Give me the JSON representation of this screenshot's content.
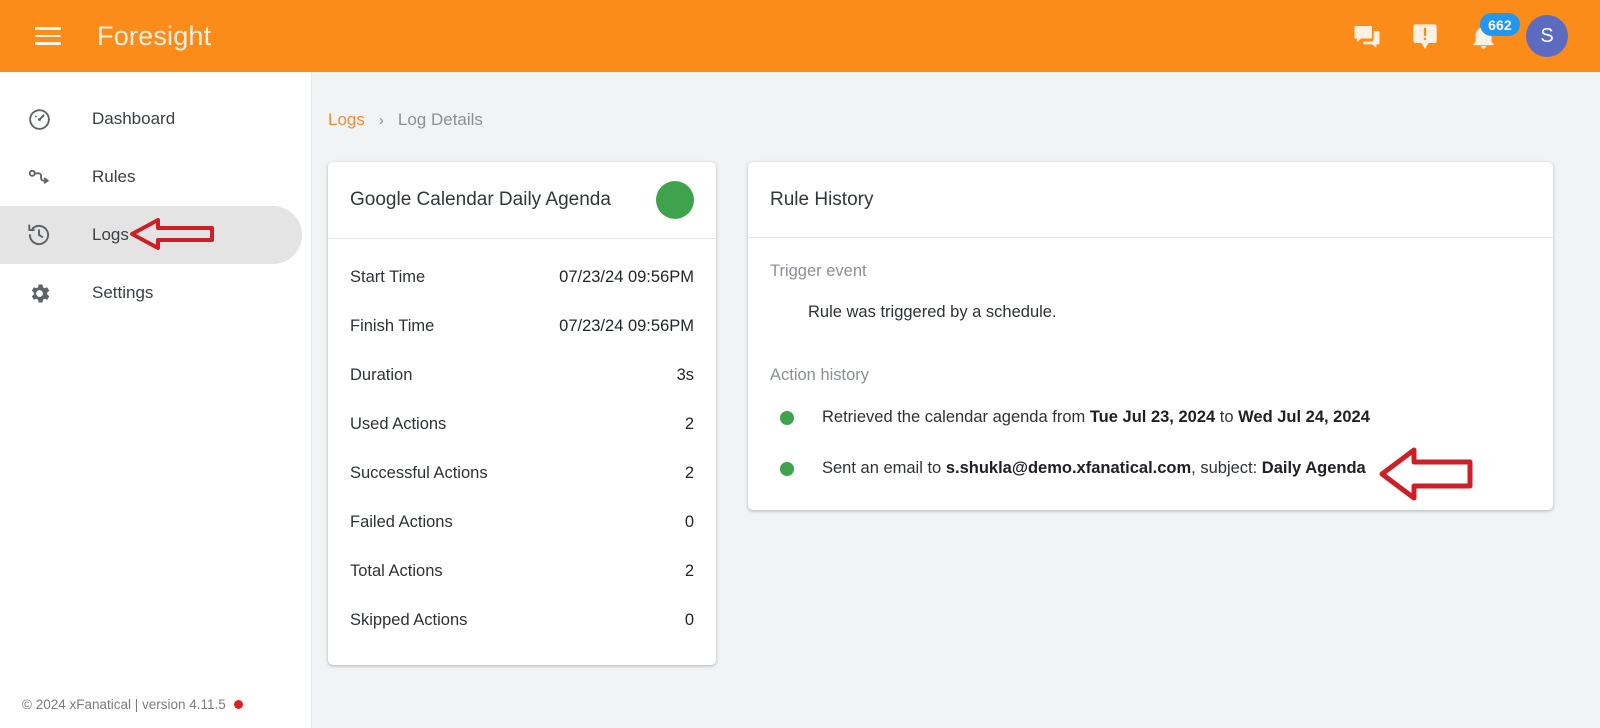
{
  "appbar": {
    "title": "Foresight",
    "menu_icon": "hamburger-menu-icon",
    "chat_icon": "forum-chat-icon",
    "feedback_icon": "feedback-exclamation-icon",
    "bell_icon": "notification-bell-icon",
    "notification_count": "662",
    "avatar_initial": "S",
    "bg_color": "#fb8c1a",
    "badge_color": "#2196f3",
    "avatar_color": "#5c6bc0"
  },
  "sidebar": {
    "items": [
      {
        "label": "Dashboard",
        "icon": "speedometer-dashboard-icon",
        "active": false
      },
      {
        "label": "Rules",
        "icon": "rules-flow-icon",
        "active": false
      },
      {
        "label": "Logs",
        "icon": "history-clock-icon",
        "active": true
      },
      {
        "label": "Settings",
        "icon": "gear-settings-icon",
        "active": false
      }
    ],
    "footer": {
      "text": "© 2024 xFanatical | version 4.11.5",
      "status_dot_color": "#e02020"
    }
  },
  "breadcrumb": {
    "root": "Logs",
    "separator": "›",
    "current": "Log Details"
  },
  "summary": {
    "title": "Google Calendar Daily Agenda",
    "status_color": "#3fa34d",
    "rows": [
      {
        "label": "Start Time",
        "value": "07/23/24 09:56PM"
      },
      {
        "label": "Finish Time",
        "value": "07/23/24 09:56PM"
      },
      {
        "label": "Duration",
        "value": "3s"
      },
      {
        "label": "Used Actions",
        "value": "2"
      },
      {
        "label": "Successful Actions",
        "value": "2"
      },
      {
        "label": "Failed Actions",
        "value": "0"
      },
      {
        "label": "Total Actions",
        "value": "2"
      },
      {
        "label": "Skipped Actions",
        "value": "0"
      }
    ]
  },
  "history": {
    "title": "Rule History",
    "trigger_label": "Trigger event",
    "trigger_text": "Rule was triggered by a schedule.",
    "action_label": "Action history",
    "actions": [
      {
        "bullet_color": "#3fa34d",
        "parts": [
          {
            "text": "Retrieved the calendar agenda from ",
            "bold": false
          },
          {
            "text": "Tue Jul 23, 2024",
            "bold": true
          },
          {
            "text": " to ",
            "bold": false
          },
          {
            "text": "Wed Jul 24, 2024",
            "bold": true
          }
        ]
      },
      {
        "bullet_color": "#3fa34d",
        "parts": [
          {
            "text": "Sent an email to ",
            "bold": false
          },
          {
            "text": "s.shukla@demo.xfanatical.com",
            "bold": true
          },
          {
            "text": ", subject: ",
            "bold": false
          },
          {
            "text": "Daily Agenda",
            "bold": true
          }
        ]
      }
    ]
  },
  "annotations": [
    {
      "name": "arrow-pointing-to-logs-nav",
      "direction": "left",
      "color": "#cc2026"
    },
    {
      "name": "arrow-pointing-to-first-action-history",
      "direction": "left",
      "color": "#cc2026"
    }
  ]
}
